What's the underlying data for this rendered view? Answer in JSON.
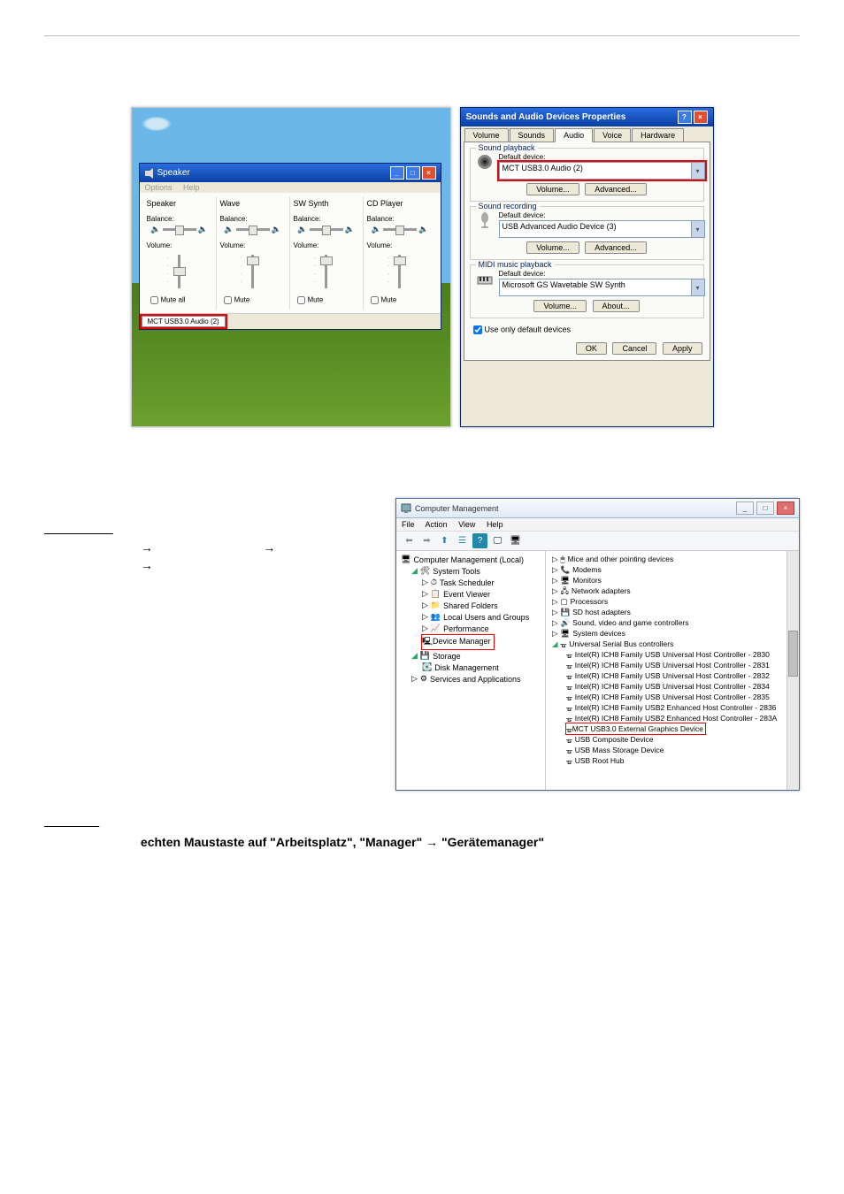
{
  "speaker": {
    "title": "Speaker",
    "menu": {
      "options": "Options",
      "help": "Help"
    },
    "cols": [
      "Speaker",
      "Wave",
      "SW Synth",
      "CD Player"
    ],
    "balance_label": "Balance:",
    "volume_label": "Volume:",
    "mute_all": "Mute all",
    "mute": "Mute",
    "status_device": "MCT USB3.0 Audio (2)"
  },
  "snd": {
    "title": "Sounds and Audio Devices Properties",
    "tabs": [
      "Volume",
      "Sounds",
      "Audio",
      "Voice",
      "Hardware"
    ],
    "active_tab": "Audio",
    "playback": {
      "legend": "Sound playback",
      "default_label": "Default device:",
      "device": "MCT USB3.0 Audio (2)",
      "btn1": "Volume...",
      "btn2": "Advanced..."
    },
    "recording": {
      "legend": "Sound recording",
      "default_label": "Default device:",
      "device": "USB Advanced Audio Device (3)",
      "btn1": "Volume...",
      "btn2": "Advanced..."
    },
    "midi": {
      "legend": "MIDI music playback",
      "default_label": "Default device:",
      "device": "Microsoft GS Wavetable SW Synth",
      "btn1": "Volume...",
      "btn2": "About..."
    },
    "use_only_default": "Use only default devices",
    "ok": "OK",
    "cancel": "Cancel",
    "apply": "Apply"
  },
  "cm": {
    "title": "Computer Management",
    "menu": {
      "file": "File",
      "action": "Action",
      "view": "View",
      "help": "Help"
    },
    "tree": {
      "root": "Computer Management (Local)",
      "systools": "System Tools",
      "tasksched": "Task Scheduler",
      "eventviewer": "Event Viewer",
      "sharedfolders": "Shared Folders",
      "localusers": "Local Users and Groups",
      "performance": "Performance",
      "devicemgr": "Device Manager",
      "storage": "Storage",
      "diskmgmt": "Disk Management",
      "services": "Services and Applications"
    },
    "devs": {
      "mice": "Mice and other pointing devices",
      "modems": "Modems",
      "monitors": "Monitors",
      "netadapters": "Network adapters",
      "processors": "Processors",
      "sdhost": "SD host adapters",
      "soundvideo": "Sound, video and game controllers",
      "sysdevices": "System devices",
      "usbcontrollers": "Universal Serial Bus controllers",
      "usb0": "Intel(R) ICH8 Family USB Universal Host Controller - 2830",
      "usb1": "Intel(R) ICH8 Family USB Universal Host Controller - 2831",
      "usb2": "Intel(R) ICH8 Family USB Universal Host Controller - 2832",
      "usb4": "Intel(R) ICH8 Family USB Universal Host Controller - 2834",
      "usb5": "Intel(R) ICH8 Family USB Universal Host Controller - 2835",
      "usb6": "Intel(R) ICH8 Family USB2 Enhanced Host Controller - 2836",
      "usbA": "Intel(R) ICH8 Family USB2 Enhanced Host Controller - 283A",
      "mct": "MCT USB3.0 External Graphics Device",
      "usbcomposite": "USB Composite Device",
      "usbmass": "USB Mass Storage Device",
      "usbroothub": "USB Root Hub"
    }
  },
  "text": {
    "de_line": "echten Maustaste auf \"Arbeitsplatz\", \"Manager\" →  \"Gerätemanager\""
  }
}
